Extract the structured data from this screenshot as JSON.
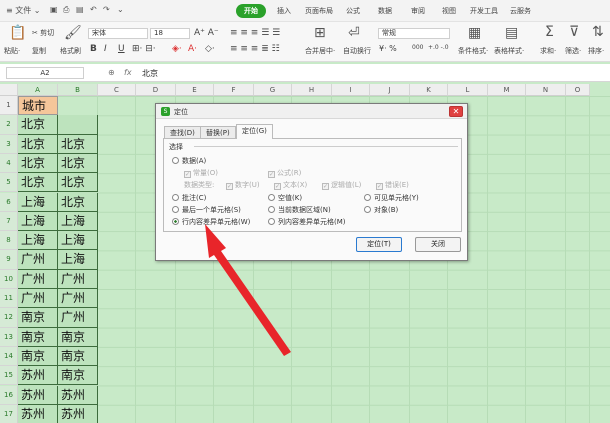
{
  "menu": {
    "file": "≡ 文件 ⌄",
    "tabs": [
      "开始",
      "插入",
      "页面布局",
      "公式",
      "数据",
      "审阅",
      "视图",
      "开发工具",
      "云服务"
    ],
    "active_tab": "开始"
  },
  "ribbon": {
    "paste": "粘贴·",
    "cut": "✂ 剪切",
    "copy": "复制",
    "format_painter": "格式刷",
    "font_name": "宋体",
    "font_size": "18",
    "bold": "B",
    "italic": "I",
    "underline": "U",
    "merge_center": "合并居中·",
    "wrap": "自动换行",
    "number_format": "常规",
    "currency": "¥· %",
    "thousands": "000",
    "cond_format": "条件格式·",
    "table_style": "表格样式·",
    "sum": "求和·",
    "filter": "筛选·",
    "sort": "排序·"
  },
  "formula_bar": {
    "name_box": "A2",
    "fx": "fx",
    "value": "北京"
  },
  "columns": [
    "A",
    "B",
    "C",
    "D",
    "E",
    "F",
    "G",
    "H",
    "I",
    "J",
    "K",
    "L",
    "M",
    "N",
    "O"
  ],
  "rows": [
    "1",
    "2",
    "3",
    "4",
    "5",
    "6",
    "7",
    "8",
    "9",
    "10",
    "11",
    "12",
    "13",
    "14",
    "15",
    "16",
    "17"
  ],
  "cells": [
    [
      "城市",
      ""
    ],
    [
      "北京",
      ""
    ],
    [
      "北京",
      "北京"
    ],
    [
      "北京",
      "北京"
    ],
    [
      "北京",
      "北京"
    ],
    [
      "上海",
      "北京"
    ],
    [
      "上海",
      "上海"
    ],
    [
      "上海",
      "上海"
    ],
    [
      "广州",
      "上海"
    ],
    [
      "广州",
      "广州"
    ],
    [
      "广州",
      "广州"
    ],
    [
      "南京",
      "广州"
    ],
    [
      "南京",
      "南京"
    ],
    [
      "南京",
      "南京"
    ],
    [
      "苏州",
      "南京"
    ],
    [
      "苏州",
      "苏州"
    ],
    [
      "苏州",
      "苏州"
    ]
  ],
  "dialog": {
    "title": "定位",
    "close": "✕",
    "tabs": [
      "查找(D)",
      "替换(P)",
      "定位(G)"
    ],
    "active_tab": "定位(G)",
    "group_label": "选择",
    "opt_data": "数据(A)",
    "opt_constant": "常量(O)",
    "opt_formula": "公式(R)",
    "data_type_label": "数据类型:",
    "opt_number": "数字(U)",
    "opt_text": "文本(X)",
    "opt_logical": "逻辑值(L)",
    "opt_error": "错误(E)",
    "opt_comment": "批注(C)",
    "opt_blank": "空值(K)",
    "opt_visible": "可见单元格(Y)",
    "opt_last_cell": "最后一个单元格(S)",
    "opt_current_region": "当前数据区域(N)",
    "opt_object": "对象(B)",
    "opt_row_diff": "行内容差异单元格(W)",
    "opt_col_diff": "列内容差异单元格(M)",
    "btn_locate": "定位(T)",
    "btn_close": "关闭"
  },
  "colors": {
    "accent": "#2aa12a",
    "arrow": "#e8252a",
    "grid_bg": "#c8eac8",
    "header_cell": "#f5c69a"
  }
}
